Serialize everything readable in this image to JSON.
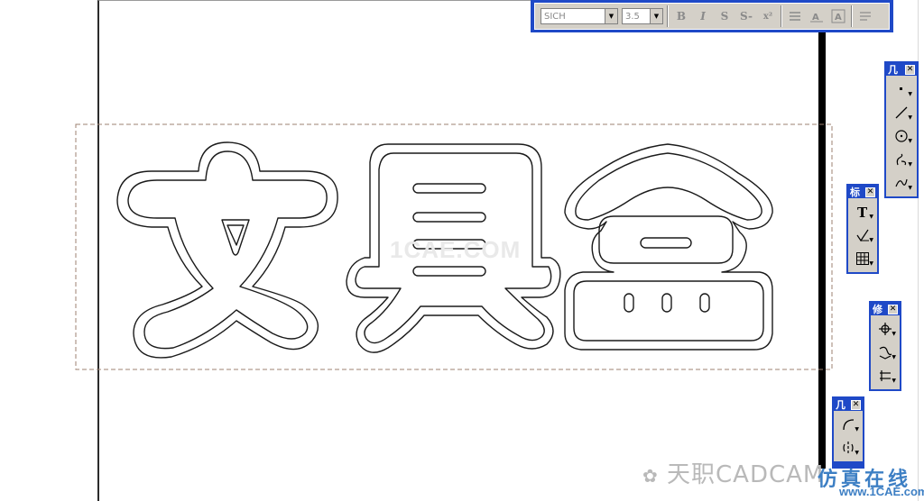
{
  "drawing": {
    "characters": [
      "文",
      "具",
      "盒"
    ],
    "center_watermark": "1CAE.COM"
  },
  "text_toolbar": {
    "font_value": "SICH",
    "size_value": "3.5",
    "buttons": [
      "B",
      "I",
      "S",
      "S-",
      "x²"
    ]
  },
  "palettes": [
    {
      "title": "几",
      "close": "✕"
    },
    {
      "title": "标",
      "close": "✕"
    },
    {
      "title": "修",
      "close": "✕"
    },
    {
      "title": "几",
      "close": "✕"
    }
  ],
  "footer_watermark": {
    "account": "天职CADCAM",
    "site_cn": "仿真在线",
    "site_url": "www.1CAE.com"
  },
  "colors": {
    "title_blue": "#1f49c7",
    "panel_gray": "#d4d0c8",
    "outline": "#1a1a1a",
    "frame_dash": "#9c8070"
  }
}
